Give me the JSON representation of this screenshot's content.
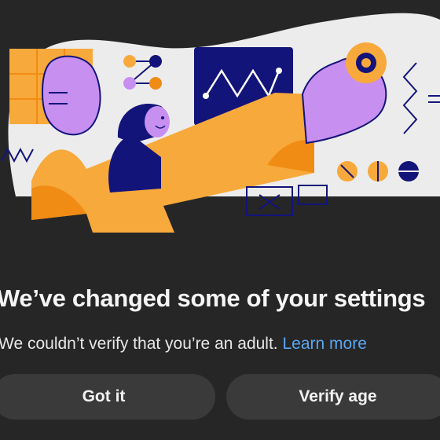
{
  "illustration": {
    "icon": "person-adjusting-settings-illustration",
    "colors": {
      "background_blob": "#ececec",
      "orange": "#f7a93b",
      "dark_orange": "#f08c14",
      "purple": "#c78ff0",
      "navy": "#13147a"
    }
  },
  "dialog": {
    "title": "We’ve changed some of your settings",
    "message": "We couldn’t verify that you’re an adult.",
    "learn_more": "Learn more"
  },
  "actions": {
    "got_it": "Got it",
    "verify_age": "Verify age"
  },
  "colors": {
    "page_background": "#262626",
    "button_background": "#3a3a3a",
    "link": "#5aa6f0"
  }
}
